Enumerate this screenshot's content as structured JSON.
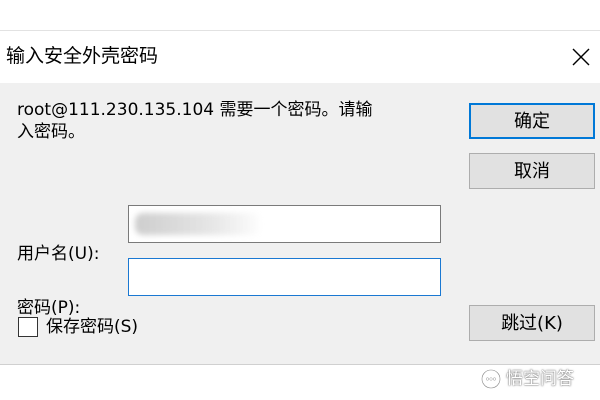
{
  "dialog": {
    "title": "输入安全外壳密码",
    "prompt_line1": "root@111.230.135.104 需要一个密码。请输",
    "prompt_line2": "入密码。"
  },
  "form": {
    "username_label": "用户名(U):",
    "username_value": "",
    "password_label": "密码(P):",
    "password_value": "",
    "save_password_label": "保存密码(S)",
    "save_password_checked": false
  },
  "buttons": {
    "ok_label": "确定",
    "cancel_label": "取消",
    "skip_label": "跳过(K)"
  },
  "watermark": {
    "text": "悟空问答"
  },
  "icons": {
    "close": "close-icon",
    "watermark": "chat-bubble-icon"
  },
  "colors": {
    "dialog_bg": "#f0f0f0",
    "focus_border": "#1a78d2",
    "default_button_border": "#0078d7"
  }
}
